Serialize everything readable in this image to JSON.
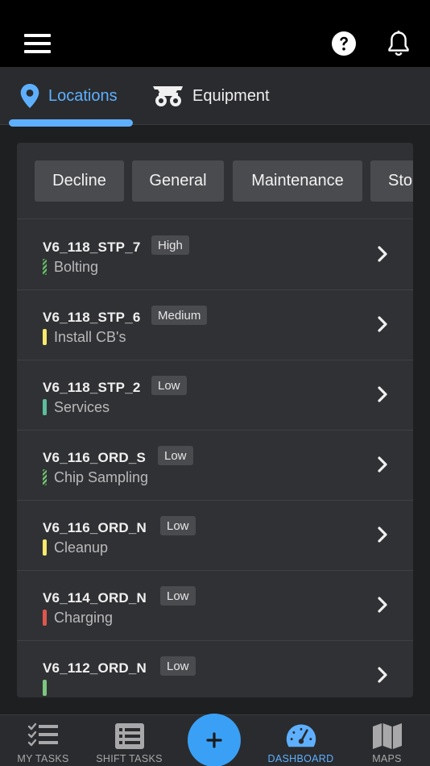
{
  "header": {
    "menu_icon": "hamburger-menu-icon",
    "help_icon": "help-circle-icon",
    "notification_icon": "bell-icon"
  },
  "tabs": [
    {
      "label": "Locations",
      "icon": "location-pin-icon",
      "active": true
    },
    {
      "label": "Equipment",
      "icon": "mining-truck-icon",
      "active": false
    }
  ],
  "filters": [
    "Decline",
    "General",
    "Maintenance",
    "Sto"
  ],
  "tasks": [
    {
      "location": "V6_118_STP_7",
      "priority": "High",
      "task": "Bolting",
      "bar_color": "#6fbf73",
      "striped": true
    },
    {
      "location": "V6_118_STP_6",
      "priority": "Medium",
      "task": "Install CB's",
      "bar_color": "#f6e96b",
      "striped": false
    },
    {
      "location": "V6_118_STP_2",
      "priority": "Low",
      "task": "Services",
      "bar_color": "#5bbf9a",
      "striped": false
    },
    {
      "location": "V6_116_ORD_S",
      "priority": "Low",
      "task": "Chip Sampling",
      "bar_color": "#7cc67f",
      "striped": true
    },
    {
      "location": "V6_116_ORD_N",
      "priority": "Low",
      "task": "Cleanup",
      "bar_color": "#f6e96b",
      "striped": false
    },
    {
      "location": "V6_114_ORD_N",
      "priority": "Low",
      "task": "Charging",
      "bar_color": "#e0564f",
      "striped": false
    },
    {
      "location": "V6_112_ORD_N",
      "priority": "Low",
      "task": "",
      "bar_color": "#7cc67f",
      "striped": false
    }
  ],
  "bottom_nav": [
    {
      "label": "MY TASKS",
      "icon": "checklist-icon",
      "active": false
    },
    {
      "label": "SHIFT TASKS",
      "icon": "list-icon",
      "active": false
    },
    {
      "label": "DASHBOARD",
      "icon": "speedometer-icon",
      "active": true
    },
    {
      "label": "MAPS",
      "icon": "map-icon",
      "active": false
    }
  ],
  "fab": {
    "symbol": "+",
    "icon": "add-icon"
  },
  "colors": {
    "accent": "#5eb0ff",
    "fab": "#3aa0f5",
    "background": "#1e1f21",
    "card": "#303134"
  }
}
